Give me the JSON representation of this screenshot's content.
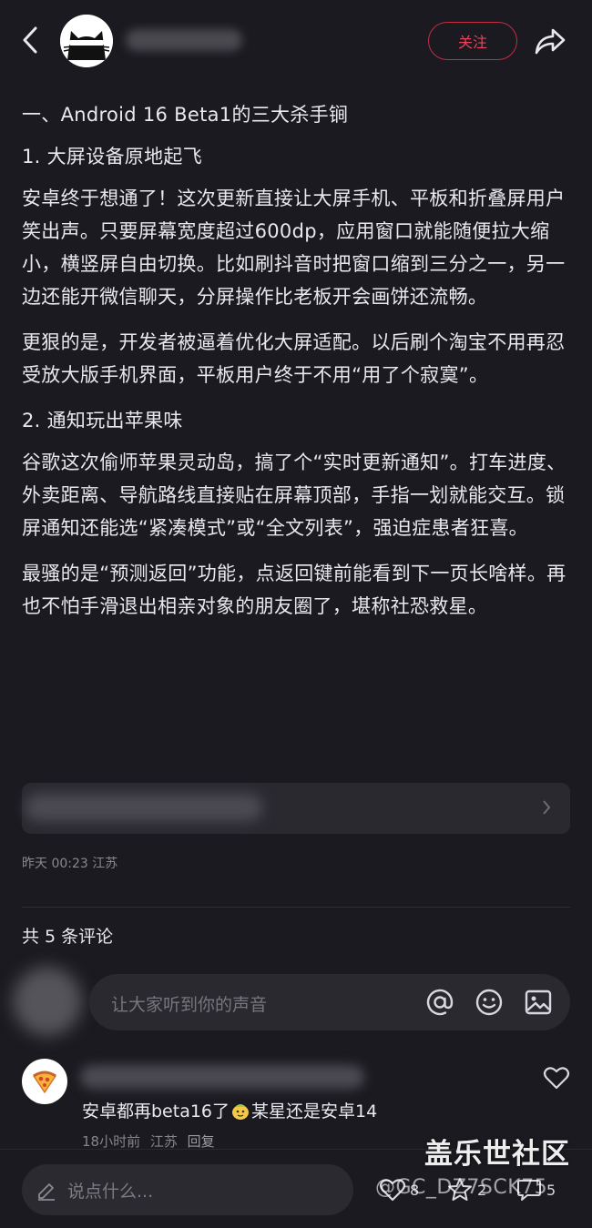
{
  "header": {
    "follow_label": "关注",
    "icons": [
      "back-arrow-icon",
      "share-arrow-icon"
    ]
  },
  "article": {
    "paragraphs": [
      "一、Android 16 Beta1的三大杀手锏",
      "1. 大屏设备原地起飞",
      "安卓终于想通了！这次更新直接让大屏手机、平板和折叠屏用户笑出声。只要屏幕宽度超过600dp，应用窗口就能随便拉大缩小，横竖屏自由切换。比如刷抖音时把窗口缩到三分之一，另一边还能开微信聊天，分屏操作比老板开会画饼还流畅。",
      "更狠的是，开发者被逼着优化大屏适配。以后刷个淘宝不用再忍受放大版手机界面，平板用户终于不用“用了个寂寞”。",
      "2. 通知玩出苹果味",
      "谷歌这次偷师苹果灵动岛，搞了个“实时更新通知”。打车进度、外卖距离、导航路线直接贴在屏幕顶部，手指一划就能交互。锁屏通知还能选“紧凑模式”或“全文列表”，强迫症患者狂喜。",
      "最骚的是“预测返回”功能，点返回键前能看到下一页长啥样。再也不怕手滑退出相亲对象的朋友圈了，堪称社恐救星。"
    ]
  },
  "post_meta": {
    "time": "昨天 00:23",
    "location": "江苏"
  },
  "comments": {
    "count_label": "共 5 条评论",
    "input_placeholder": "让大家听到你的声音",
    "input_icons": [
      "at-icon",
      "emoji-icon",
      "image-icon"
    ],
    "items": [
      {
        "text_before": "安卓都再beta16了",
        "text_after": "某星还是安卓14",
        "time": "18小时前",
        "location": "江苏",
        "reply_label": "回复"
      }
    ]
  },
  "bottom_bar": {
    "placeholder": "说点什么...",
    "like_count": "8",
    "collect_count": "2",
    "comment_count": "5"
  },
  "watermark": {
    "brand": "盖乐世社区",
    "handle": "@GC_DZ7SCK75"
  },
  "colors": {
    "background": "#1b1a20",
    "accent": "#e8455c",
    "text": "#e9e8ee",
    "muted": "#8a8990"
  }
}
